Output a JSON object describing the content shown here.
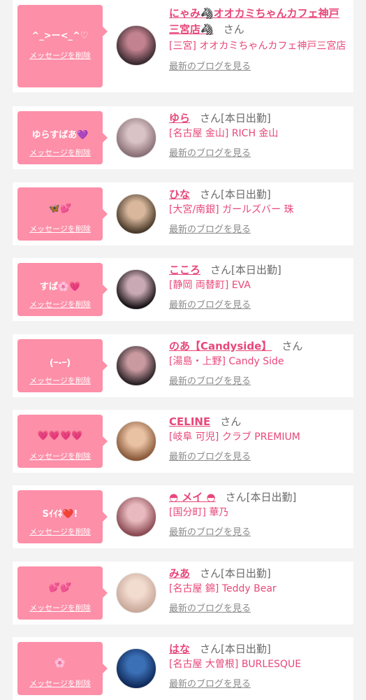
{
  "delete_label": "メッセージを削除",
  "blog_label": "最新のブログを見る",
  "san_label": "さん",
  "colors": {
    "accent": "#e8477a",
    "bubble": "#fd8fa8",
    "background": "#f3f3f3"
  },
  "items": [
    {
      "message": "^_>ー<_^♡",
      "name": "にゃみ🦓オオカミちゃんカフェ神戸三宮店🦓",
      "status": "",
      "shop": "[三宮] オオカミちゃんカフェ神戸三宮店",
      "avatar_colors": [
        "#3a2a30",
        "#c3828f"
      ]
    },
    {
      "message": "ゆらすばあ💜",
      "name": "ゆら",
      "status": "[本日出勤]",
      "shop": "[名古屋 金山] RICH 金山",
      "avatar_colors": [
        "#8a7077",
        "#d9c3c6"
      ]
    },
    {
      "message": "🦋💕",
      "name": "ひな",
      "status": "[本日出勤]",
      "shop": "[大宮/南銀] ガールズバー 珠",
      "avatar_colors": [
        "#4a3a2a",
        "#d8b79c"
      ]
    },
    {
      "message": "すば🌸💗",
      "name": "こころ",
      "status": "[本日出勤]",
      "shop": "[静岡 両替町] EVA",
      "avatar_colors": [
        "#1a1418",
        "#c9a9b3"
      ]
    },
    {
      "message": "(ｰ-ｰ)",
      "name": "のあ【Candyside】",
      "status": "",
      "shop": "[湯島・上野] Candy Side",
      "avatar_colors": [
        "#2a2226",
        "#c99aa0"
      ]
    },
    {
      "message": "💗💗💗💗",
      "name": "CELINE",
      "status": "",
      "shop": "[岐阜 可児] クラブ PREMIUM",
      "avatar_colors": [
        "#8a5a3a",
        "#e9c2a3"
      ]
    },
    {
      "message": "Sｲｲﾈ❤️!",
      "name": "◓ メイ ◓",
      "status": "[本日出勤]",
      "shop": "[国分町] 華乃",
      "avatar_colors": [
        "#8a4a52",
        "#e8b9bf"
      ]
    },
    {
      "message": "💕💕",
      "name": "みあ",
      "status": "[本日出勤]",
      "shop": "[名古屋 錦] Teddy Bear",
      "avatar_colors": [
        "#caa99a",
        "#f2dcd0"
      ]
    },
    {
      "message": "🌸",
      "name": "はな",
      "status": "[本日出勤]",
      "shop": "[名古屋 大曽根] BURLESQUE",
      "avatar_colors": [
        "#0f2a5a",
        "#3b6fb6"
      ]
    }
  ]
}
